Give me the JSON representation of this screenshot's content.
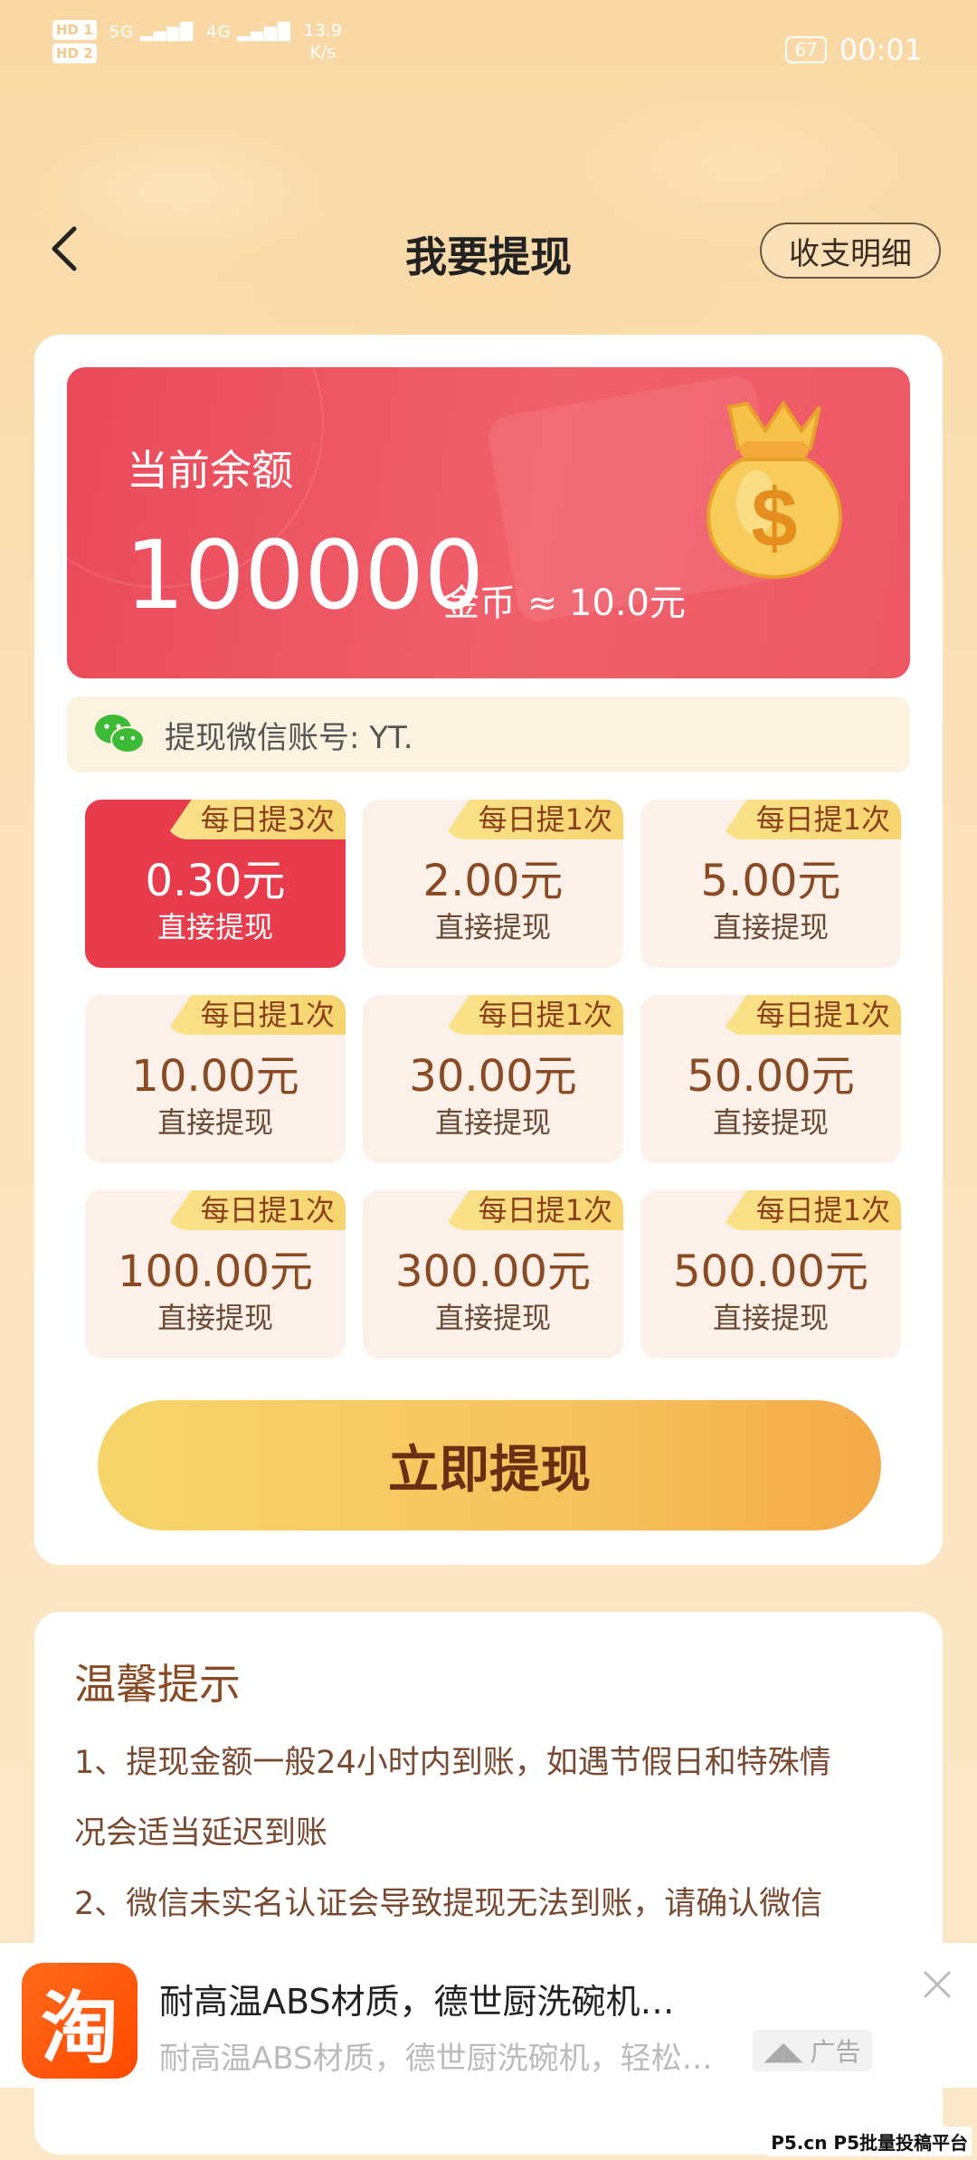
{
  "status_bar": {
    "hd1": "HD 1",
    "hd2": "HD 2",
    "sig1": "5G",
    "sig2": "4G",
    "speed": "13.9",
    "speed_unit": "K/s",
    "battery": "67",
    "time": "00:01"
  },
  "header": {
    "title": "我要提现",
    "ledger_label": "收支明细"
  },
  "balance": {
    "label": "当前余额",
    "amount": "100000",
    "unit": "金币 ≈ 10.0元"
  },
  "wechat": {
    "label": "提现微信账号: YT."
  },
  "options": [
    {
      "tag": "每日提3次",
      "amount": "0.30元",
      "sub": "直接提现",
      "selected": true
    },
    {
      "tag": "每日提1次",
      "amount": "2.00元",
      "sub": "直接提现",
      "selected": false
    },
    {
      "tag": "每日提1次",
      "amount": "5.00元",
      "sub": "直接提现",
      "selected": false
    },
    {
      "tag": "每日提1次",
      "amount": "10.00元",
      "sub": "直接提现",
      "selected": false
    },
    {
      "tag": "每日提1次",
      "amount": "30.00元",
      "sub": "直接提现",
      "selected": false
    },
    {
      "tag": "每日提1次",
      "amount": "50.00元",
      "sub": "直接提现",
      "selected": false
    },
    {
      "tag": "每日提1次",
      "amount": "100.00元",
      "sub": "直接提现",
      "selected": false
    },
    {
      "tag": "每日提1次",
      "amount": "300.00元",
      "sub": "直接提现",
      "selected": false
    },
    {
      "tag": "每日提1次",
      "amount": "500.00元",
      "sub": "直接提现",
      "selected": false
    }
  ],
  "submit_label": "立即提现",
  "tips": {
    "title": "温馨提示",
    "line1": "1、提现金额一般24小时内到账，如遇节假日和特殊情",
    "line2": "况会适当延迟到账",
    "line3": "2、微信未实名认证会导致提现无法到账，请确认微信"
  },
  "ad": {
    "logo_char": "淘",
    "title": "耐高温ABS材质，德世厨洗碗机…",
    "desc": "耐高温ABS材质，德世厨洗碗机，轻松…",
    "badge": "广告"
  },
  "watermark": "P5.cn P5批量投稿平台"
}
